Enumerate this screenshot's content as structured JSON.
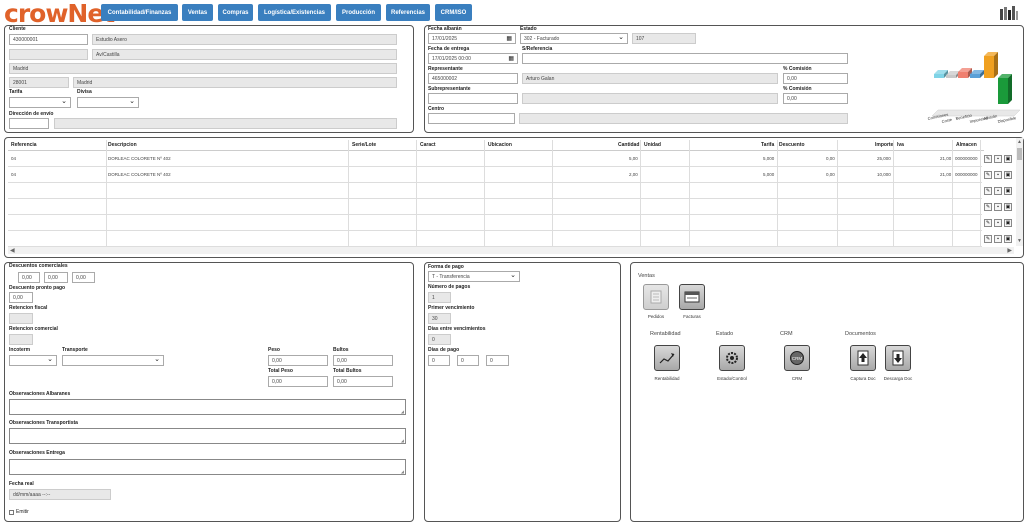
{
  "app": {
    "logo": "crowNet"
  },
  "nav": [
    "Contabilidad/Finanzas",
    "Ventas",
    "Compras",
    "Logística/Existencias",
    "Producción",
    "Referencias",
    "CRM/ISO"
  ],
  "client": {
    "label": "Cliente",
    "code": "430000001",
    "name": "Estudio Asero",
    "address": "Av/Castilla",
    "city": "Madrid",
    "postal": "28001",
    "province": "Madrid",
    "tarifa_label": "Tarifa",
    "divisa_label": "Divisa",
    "direccion_label": "Dirección de envío"
  },
  "order": {
    "fecha_albaran_label": "Fecha albarán",
    "fecha_albaran": "17/01/2025",
    "estado_label": "Estado",
    "estado": "302 - Facturado",
    "estado_num": "107",
    "fecha_entrega_label": "Fecha de entrega",
    "fecha_entrega": "17/01/2025 00:00",
    "su_referencia_label": "S/Referencia",
    "representante_label": "Representante",
    "rep_code": "465000002",
    "rep_name": "Arturo Galan",
    "comision_label": "% Comisión",
    "comision": "0,00",
    "subrep_label": "Subrepresentante",
    "comision2": "0,00",
    "centro_label": "Centro"
  },
  "mini_chart": {
    "labels": [
      "Comisiones",
      "Coste",
      "Beneficio",
      "Impuestos",
      "Albarán",
      "Disponible"
    ],
    "colors": [
      "#7fd3e6",
      "#c9c9c9",
      "#f08070",
      "#5aa0d8",
      "#f0a020",
      "#1a9a3a"
    ]
  },
  "grid": {
    "headers": [
      "Referencia",
      "Descripcion",
      "Serie/Lote",
      "Caract",
      "Ubicacion",
      "Cantidad",
      "Unidad",
      "Tarifa",
      "Descuento",
      "Importe",
      "Iva",
      "Almacen"
    ],
    "rows": [
      {
        "ref": "04",
        "desc": "DORLEAC COLORETE Nº 402",
        "cantidad": "5,00",
        "tarifa": "5,000",
        "descuento": "0,00",
        "importe": "25,000",
        "iva": "21,00",
        "almacen": "000000000"
      },
      {
        "ref": "04",
        "desc": "DORLEAC COLORETE Nº 402",
        "cantidad": "2,00",
        "tarifa": "5,000",
        "descuento": "0,00",
        "importe": "10,000",
        "iva": "21,00",
        "almacen": "000000000"
      }
    ]
  },
  "footer_left": {
    "desc_com_label": "Descuentos comerciales",
    "d1": "0,00",
    "d2": "0,00",
    "d3": "0,00",
    "pronto_label": "Descuento pronto pago",
    "pronto": "0,00",
    "ret_fiscal_label": "Retencion fiscal",
    "ret_com_label": "Retencion comercial",
    "incoterm_label": "Incoterm",
    "transporte_label": "Transporte",
    "peso_label": "Peso",
    "peso": "0,00",
    "bultos_label": "Bultos",
    "bultos": "0,00",
    "total_peso_label": "Total Peso",
    "total_peso": "0,00",
    "total_bultos_label": "Total Bultos",
    "total_bultos": "0,00",
    "obs_alb_label": "Observaciones Albaranes",
    "obs_trans_label": "Observaciones Transportista",
    "obs_ent_label": "Observaciones Entrega",
    "fecha_real_label": "Fecha real",
    "fecha_real_ph": "dd/mm/aaaa --:--",
    "emitir_label": "Emitir"
  },
  "payment": {
    "forma_label": "Forma de pago",
    "forma": "T - Transferencia",
    "num_pagos_label": "Número de pagos",
    "num_pagos": "1",
    "primer_label": "Primer vencimiento",
    "primer": "30",
    "dias_entre_label": "Días entre vencimientos",
    "dias_entre": "0",
    "dias_pago_label": "Días de pago",
    "dp1": "0",
    "dp2": "0",
    "dp3": "0"
  },
  "actions": {
    "ventas_label": "Ventas",
    "pedidos": "Pedidos",
    "facturas": "Facturas",
    "rentabilidad_label": "Rentabilidad",
    "estado_label": "Estado",
    "crm_label": "CRM",
    "documentos_label": "Documentos",
    "rentabilidad": "Rentabilidad",
    "estado_control": "Estado/Control",
    "crm": "CRM",
    "captura": "Captura Doc",
    "descarga": "Descarga Doc"
  }
}
